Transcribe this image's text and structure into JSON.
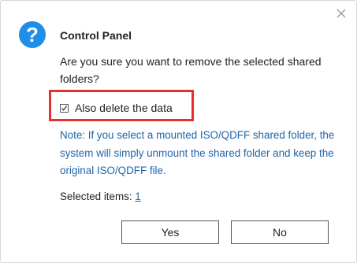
{
  "dialog": {
    "icon": "question-icon",
    "icon_glyph": "?",
    "icon_color": "#1e8ee8",
    "title": "Control Panel",
    "question": "Are you sure you want to remove the selected shared folders?",
    "checkbox": {
      "label": "Also delete the data",
      "checked": true
    },
    "note": "Note: If you select a mounted ISO/QDFF shared folder, the system will simply unmount the shared folder and keep the original ISO/QDFF file.",
    "selected_label": "Selected items: ",
    "selected_count": "1",
    "buttons": {
      "yes": "Yes",
      "no": "No"
    },
    "close_icon": "close-icon",
    "highlight_color": "#e8312c",
    "note_color": "#2065a8"
  }
}
